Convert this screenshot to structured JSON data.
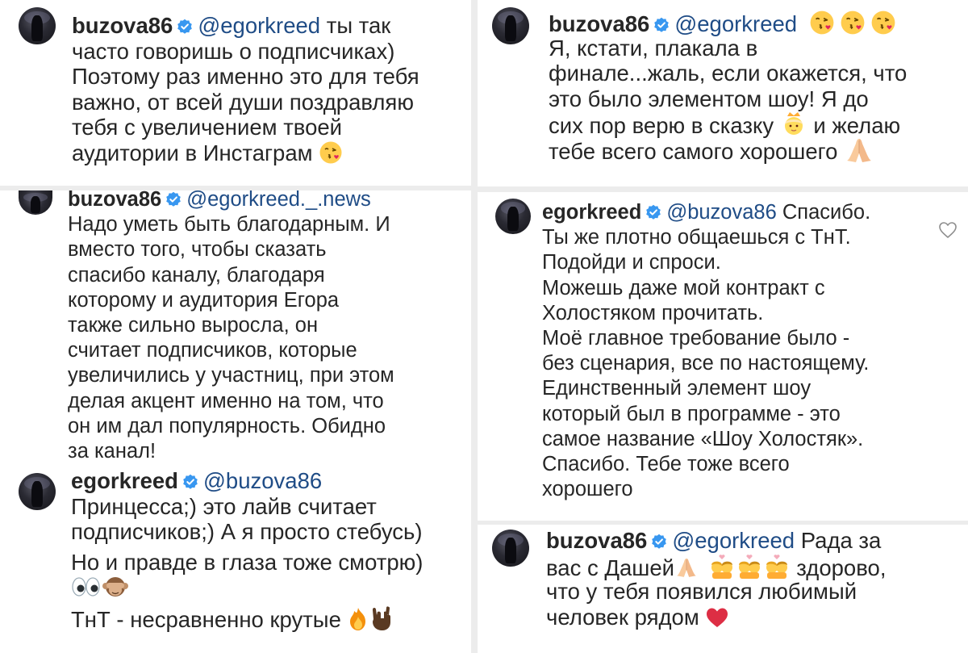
{
  "verified_color": "#3897f0",
  "accent_link_color": "#1f4c86",
  "comments": {
    "c1": {
      "username": "buzova86",
      "mention": "@egorkreed",
      "first_line_text": " ты так",
      "lines": [
        "часто говоришь о подписчиках)",
        "Поэтому раз именно это для тебя",
        "важно, от всей души поздравляю",
        "тебя с увеличением твоей",
        "аудитории в Инстаграм"
      ],
      "end_emoji": "face-blowing-kiss-icon"
    },
    "c2": {
      "username": "buzova86",
      "mention": "@egorkreed._.news",
      "lines": [
        "Надо уметь быть благодарным. И",
        "вместо того, чтобы сказать",
        "спасибо каналу, благодаря",
        "которому и аудитория Егора",
        "также сильно выросла, он",
        "считает подписчиков, которые",
        "увеличились у участниц, при этом",
        "делая акцент именно на том, что",
        "он им дал популярность. Обидно",
        "за канал!"
      ]
    },
    "c3": {
      "username": "egorkreed",
      "mention": "@buzova86",
      "lines": [
        "Принцесса;) это лайв считает",
        "подписчиков;) А я просто стебусь)",
        "Но и правде в глаза тоже смотрю)"
      ],
      "last_line": "ТнТ - несравненно крутые",
      "emoji_line": [
        "eyes-icon",
        "see-no-evil-monkey-icon"
      ],
      "end_emojis": [
        "fire-icon",
        "sign-of-horns-icon"
      ]
    },
    "c4": {
      "username": "buzova86",
      "mention": "@egorkreed",
      "header_emojis": [
        "face-blowing-kiss-icon",
        "face-blowing-kiss-icon",
        "face-blowing-kiss-icon"
      ],
      "lines": [
        "Я, кстати, плакала в",
        "финале...жаль, если окажется, что",
        "это было элементом шоу! Я до"
      ],
      "line4_before": "сих пор верю в сказку",
      "line4_after": " и желаю",
      "line4_emoji": "princess-icon",
      "line5": "тебе всего самого хорошего",
      "line5_emoji": "folded-hands-icon"
    },
    "c5": {
      "username": "egorkreed",
      "mention": "@buzova86",
      "first_line_text": " Спасибо.",
      "lines": [
        "Ты же плотно общаешься с ТнТ.",
        "Подойди и спроси.",
        "Можешь даже мой контракт с",
        "Холостяком прочитать.",
        "Моё главное требование было -",
        "без сценария, все по настоящему.",
        "Единственный элемент шоу",
        "который был в программе - это",
        "самое название «Шоу Холостяк».",
        "Спасибо. Тебе тоже всего",
        "хорошего"
      ],
      "like_icon": "heart-outline-icon"
    },
    "c6": {
      "username": "buzova86",
      "mention": "@egorkreed",
      "first_line_text": " Рада за",
      "line2_before": "вас с Дашей",
      "line2_emojis": [
        "folded-hands-icon",
        "kiss-couple-icon",
        "kiss-couple-icon",
        "kiss-couple-icon"
      ],
      "line2_after": " здорово,",
      "lines": [
        "что у тебя появился любимый"
      ],
      "last_line": "человек рядом",
      "end_emoji": "red-heart-icon"
    }
  }
}
